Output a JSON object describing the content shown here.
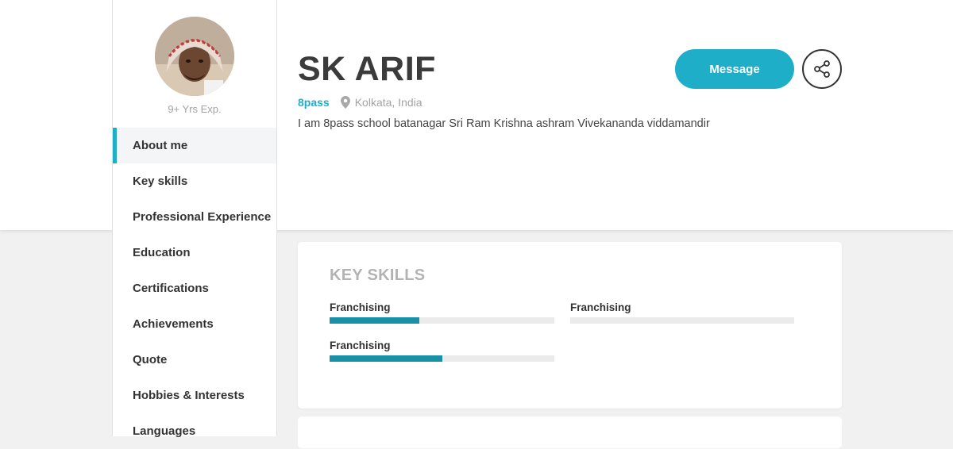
{
  "profile": {
    "name": "SK ARIF",
    "qualification": "8pass",
    "location": "Kolkata, India",
    "bio": "I am 8pass school batanagar Sri Ram Krishna ashram Vivekananda viddamandir",
    "experience": "9+ Yrs Exp."
  },
  "actions": {
    "message_label": "Message",
    "share_icon": "share-icon"
  },
  "sidebar": {
    "items": [
      {
        "label": "About me",
        "active": true
      },
      {
        "label": "Key skills"
      },
      {
        "label": "Professional Experience"
      },
      {
        "label": "Education"
      },
      {
        "label": "Certifications"
      },
      {
        "label": "Achievements"
      },
      {
        "label": "Quote"
      },
      {
        "label": "Hobbies & Interests"
      },
      {
        "label": "Languages"
      }
    ]
  },
  "key_skills": {
    "title": "KEY SKILLS",
    "skills": [
      {
        "name": "Franchising",
        "level": 0.4
      },
      {
        "name": "Franchising",
        "level": 0.0
      },
      {
        "name": "Franchising",
        "level": 0.5
      }
    ]
  },
  "colors": {
    "accent": "#1eaec8",
    "skill_bar": "#1691a5",
    "muted_text": "#a3a3a3"
  }
}
